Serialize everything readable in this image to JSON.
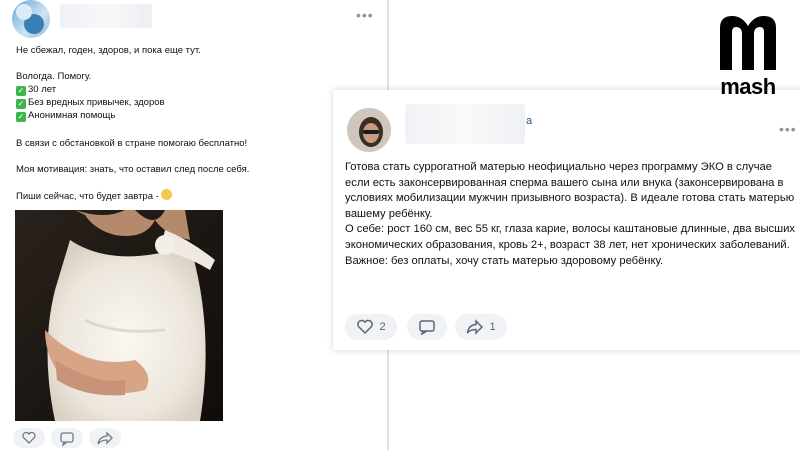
{
  "left_post": {
    "lines": [
      "Не сбежал, годен, здоров, и пока еще тут.",
      "Вологда. Помогу.",
      "30 лет",
      "Без вредных привычек, здоров",
      "Анонимная помощь",
      "В связи с обстановкой в стране помогаю бесплатно!",
      "Моя мотивация: знать, что оставил след после себя.",
      "Пиши сейчас, что будет завтра -"
    ]
  },
  "right_post": {
    "name_suffix": "а",
    "paragraphs": [
      "Готова стать суррогатной матерью неофициально через программу ЭКО в случае если есть законсервированная сперма вашего сына или внука (законсервирована в условиях мобилизации мужчин призывного возраста). В идеале готова стать матерью вашему ребёнку.",
      "О себе: рост 160 см, вес 55 кг, глаза карие, волосы каштановые длинные, два высших экономических образования, кровь 2+, возраст 38 лет, нет хронических заболеваний.",
      "Важное: без оплаты, хочу стать матерью здоровому ребёнку."
    ],
    "likes": "2",
    "shares": "1"
  },
  "logo": {
    "word": "mash"
  },
  "icons": [
    "more-dots-icon",
    "checkmark-icon",
    "heart-icon",
    "comment-icon",
    "share-icon",
    "mash-logo"
  ]
}
